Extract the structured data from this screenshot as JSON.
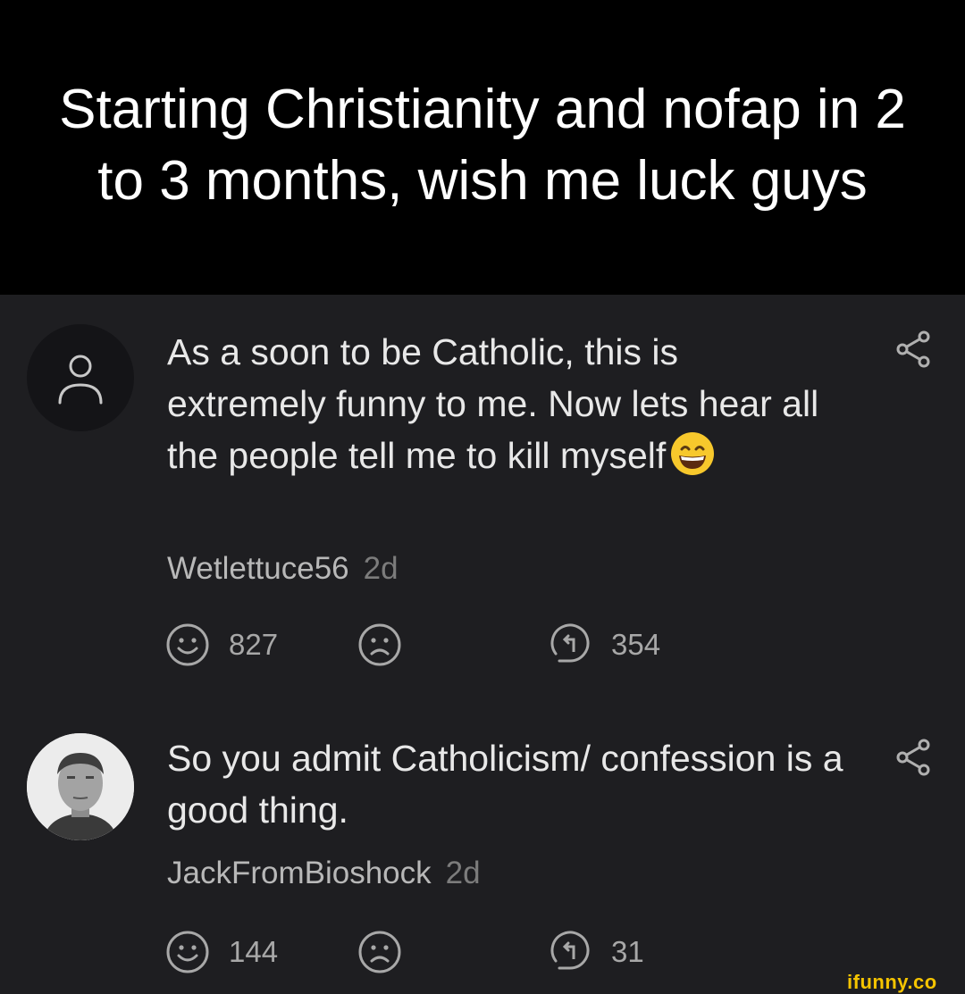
{
  "post": {
    "title": "Starting Christianity and nofap in 2 to 3 months, wish me luck guys"
  },
  "comments": [
    {
      "text": "As a soon to be Catholic, this is extremely funny to me. Now lets hear all the people tell me to kill myself",
      "emoji": "grinning-sweat-face",
      "author": "Wetlettuce56",
      "age": "2d",
      "smile_count": "827",
      "reply_count": "354",
      "avatar": "default-user-icon"
    },
    {
      "text": "So you admit Catholicism/ confession is a good thing.",
      "author": "JackFromBioshock",
      "age": "2d",
      "smile_count": "144",
      "reply_count": "31",
      "avatar": "user-photo"
    }
  ],
  "watermark": "ifunny.co",
  "colors": {
    "header_bg": "#000000",
    "page_bg": "#1e1e21",
    "text": "#e8e8e8",
    "muted": "#7c7c7c",
    "watermark": "#f5c400"
  }
}
